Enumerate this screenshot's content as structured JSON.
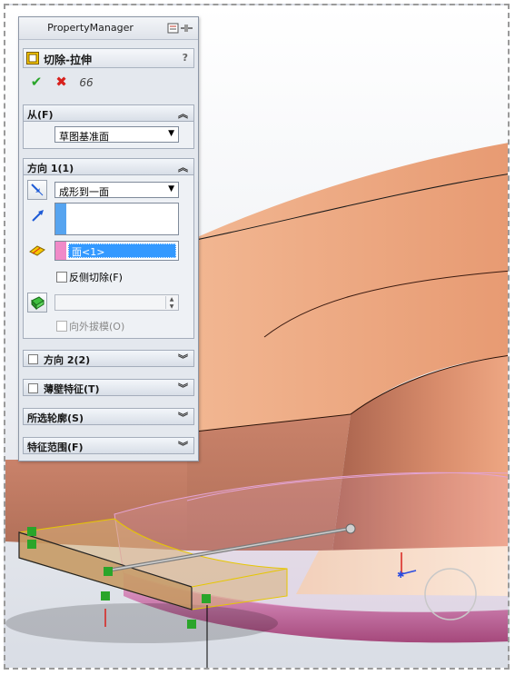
{
  "property_manager": {
    "title": "PropertyManager",
    "feature_name": "切除-拉伸",
    "help": "?",
    "actions": {
      "ok": "✔",
      "cancel": "✖",
      "preview": "66"
    }
  },
  "from_section": {
    "header": "从(F)",
    "start_condition": "草图基准面"
  },
  "direction1": {
    "header": "方向 1(1)",
    "end_condition": "成形到一面",
    "face_selection": "面<1>",
    "flip_side_label": "反侧切除(F)",
    "flip_side_checked": false,
    "draft_value": "",
    "draft_outward_label": "向外拔模(O)",
    "draft_outward_checked": false
  },
  "collapsed_sections": [
    {
      "label": "方向 2(2)",
      "checkbox": true
    },
    {
      "label": "薄壁特征(T)",
      "checkbox": true
    },
    {
      "label": "所选轮廓(S)",
      "checkbox": false
    },
    {
      "label": "特征范围(F)",
      "checkbox": false
    }
  ],
  "icons": {
    "collapse": "chevron-up-double-icon",
    "expand": "chevron-down-double-icon",
    "pin": "pin-icon"
  },
  "colors": {
    "part_orange": "#e8a079",
    "part_pink": "#e3a3d2",
    "highlight_blue": "#3399ff",
    "accept_green": "#2aa52a",
    "cancel_red": "#d8211d"
  }
}
